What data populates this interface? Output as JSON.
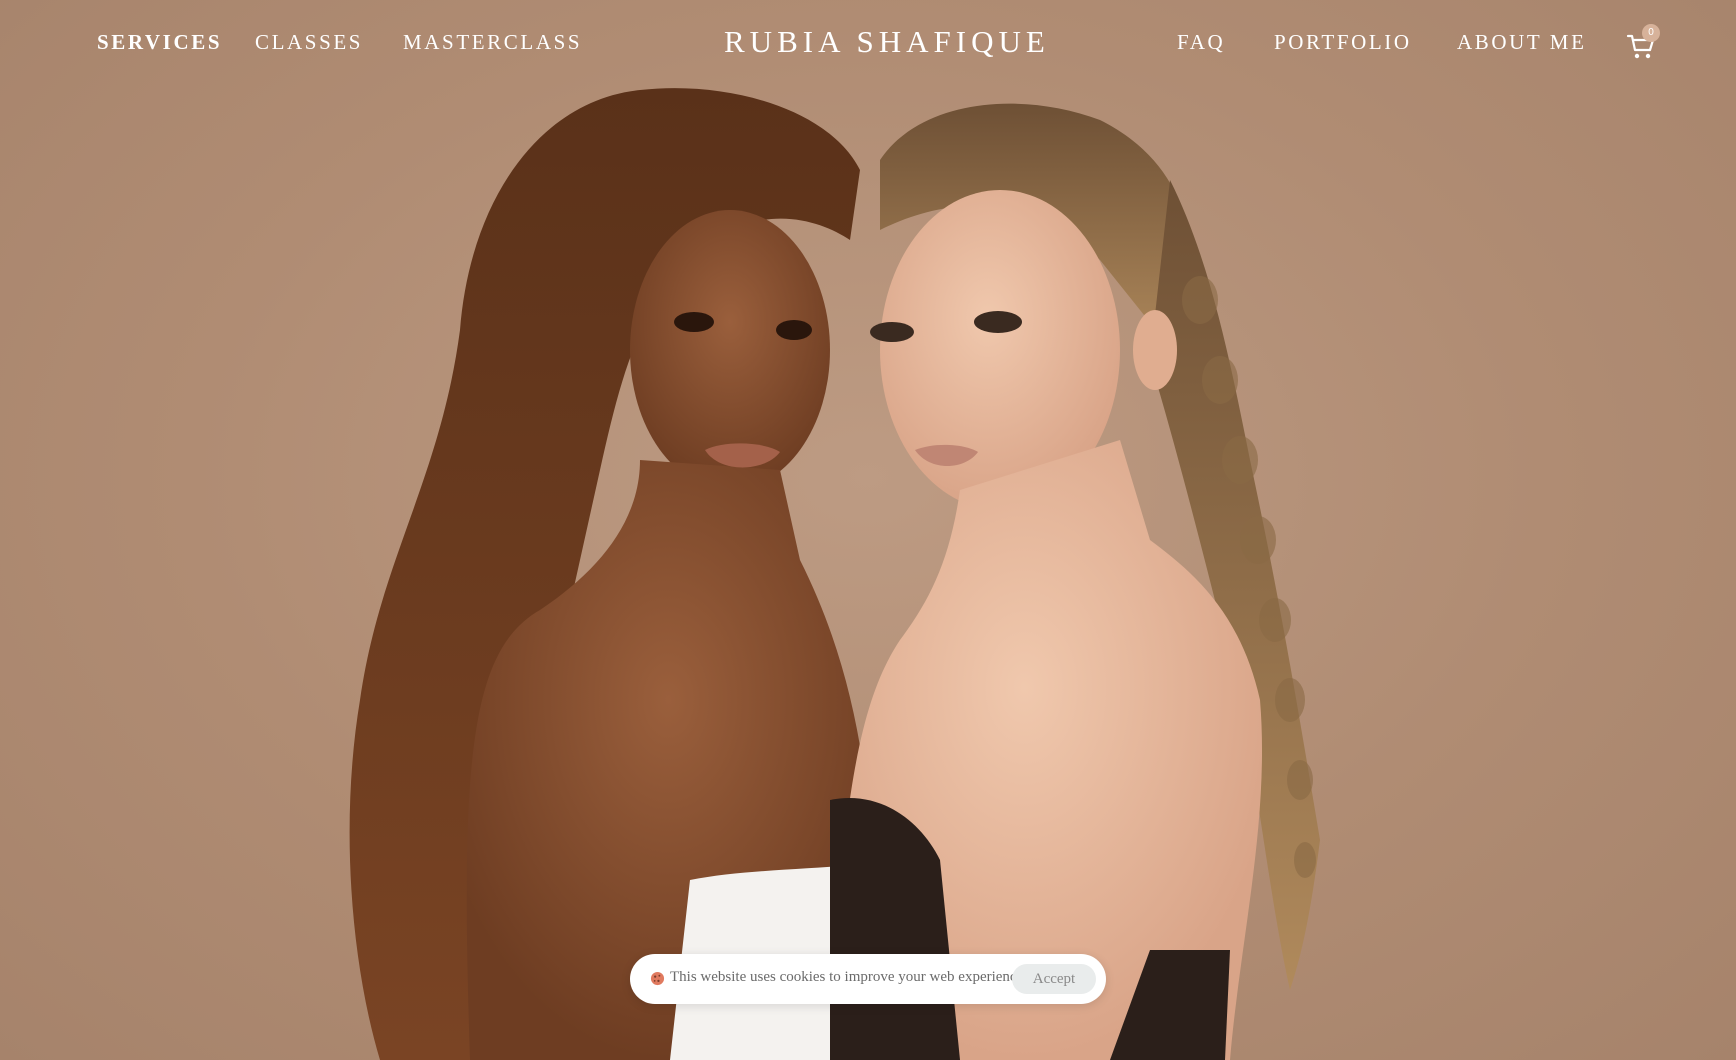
{
  "brand": {
    "name": "RUBIA SHAFIQUE"
  },
  "nav": {
    "left": [
      {
        "label": "SERVICES",
        "active": true
      },
      {
        "label": "CLASSES",
        "active": false
      },
      {
        "label": "MASTERCLASS",
        "active": false
      }
    ],
    "right": [
      {
        "label": "FAQ"
      },
      {
        "label": "PORTFOLIO"
      },
      {
        "label": "ABOUT ME"
      }
    ],
    "cart": {
      "icon": "cart-icon",
      "count": "0"
    }
  },
  "hero": {
    "image": "two-models-portrait",
    "background_color": "#b39179"
  },
  "cookie_banner": {
    "icon": "cookie-icon",
    "message": "This website uses cookies to improve your web experience.",
    "accept_label": "Accept"
  }
}
